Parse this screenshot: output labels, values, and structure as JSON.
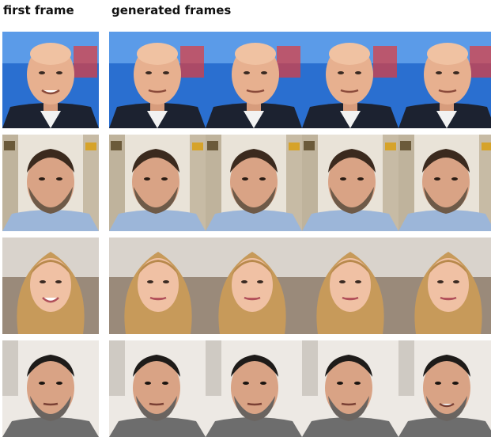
{
  "headers": {
    "first_frame": "first frame",
    "generated_frames": "generated frames"
  },
  "rows": [
    {
      "subject": "bald man in suit, news studio",
      "frames": 5
    },
    {
      "subject": "bearded man with dark hair, bookshelf",
      "frames": 5
    },
    {
      "subject": "woman with long blonde wavy hair",
      "frames": 5
    },
    {
      "subject": "man with dark hair and grey beard",
      "frames": 5
    }
  ],
  "colors": {
    "studio_blue": "#2a6fd0",
    "skin": "#e7b08f",
    "suit": "#1c2230",
    "blonde": "#c79a5a"
  }
}
